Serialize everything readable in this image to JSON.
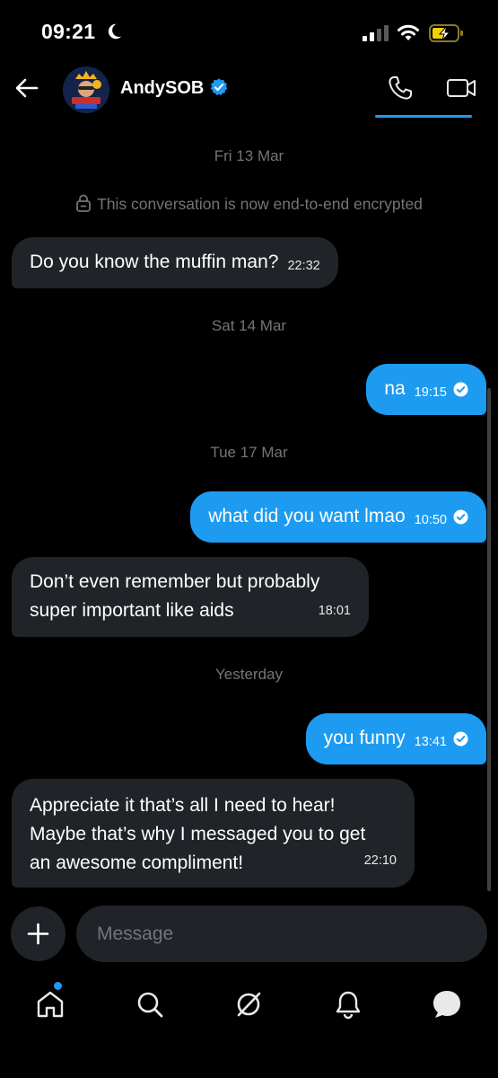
{
  "status_bar": {
    "time": "09:21"
  },
  "header": {
    "contact_name": "AndySOB"
  },
  "conversation": {
    "encryption_notice": "This conversation is now end-to-end encrypted",
    "dates": [
      "Fri 13 Mar",
      "Sat 14 Mar",
      "Tue 17 Mar",
      "Yesterday"
    ],
    "messages": [
      {
        "dir": "in",
        "lines": [
          "Do you know the muffin man?"
        ],
        "time": "22:32"
      },
      {
        "dir": "out",
        "lines": [
          "na"
        ],
        "time": "19:15"
      },
      {
        "dir": "out",
        "lines": [
          "what did you want lmao"
        ],
        "time": "10:50"
      },
      {
        "dir": "in",
        "lines": [
          "Don’t even remember but probably",
          "super important like aids"
        ],
        "time": "18:01"
      },
      {
        "dir": "out",
        "lines": [
          "you funny"
        ],
        "time": "13:41"
      },
      {
        "dir": "in",
        "lines": [
          "Appreciate it that’s all I need to hear!",
          "Maybe that’s why I messaged you to get",
          "an awesome compliment!"
        ],
        "time": "22:10"
      }
    ]
  },
  "composer": {
    "placeholder": "Message"
  },
  "bottom_nav": {
    "items": [
      "home-icon",
      "search-icon",
      "grok-icon",
      "notifications-icon",
      "messages-icon"
    ],
    "active": "messages-icon"
  },
  "colors": {
    "accent": "#1d9bf0",
    "incoming_bubble": "#202327",
    "background": "#000000",
    "muted_text": "#71767b"
  }
}
